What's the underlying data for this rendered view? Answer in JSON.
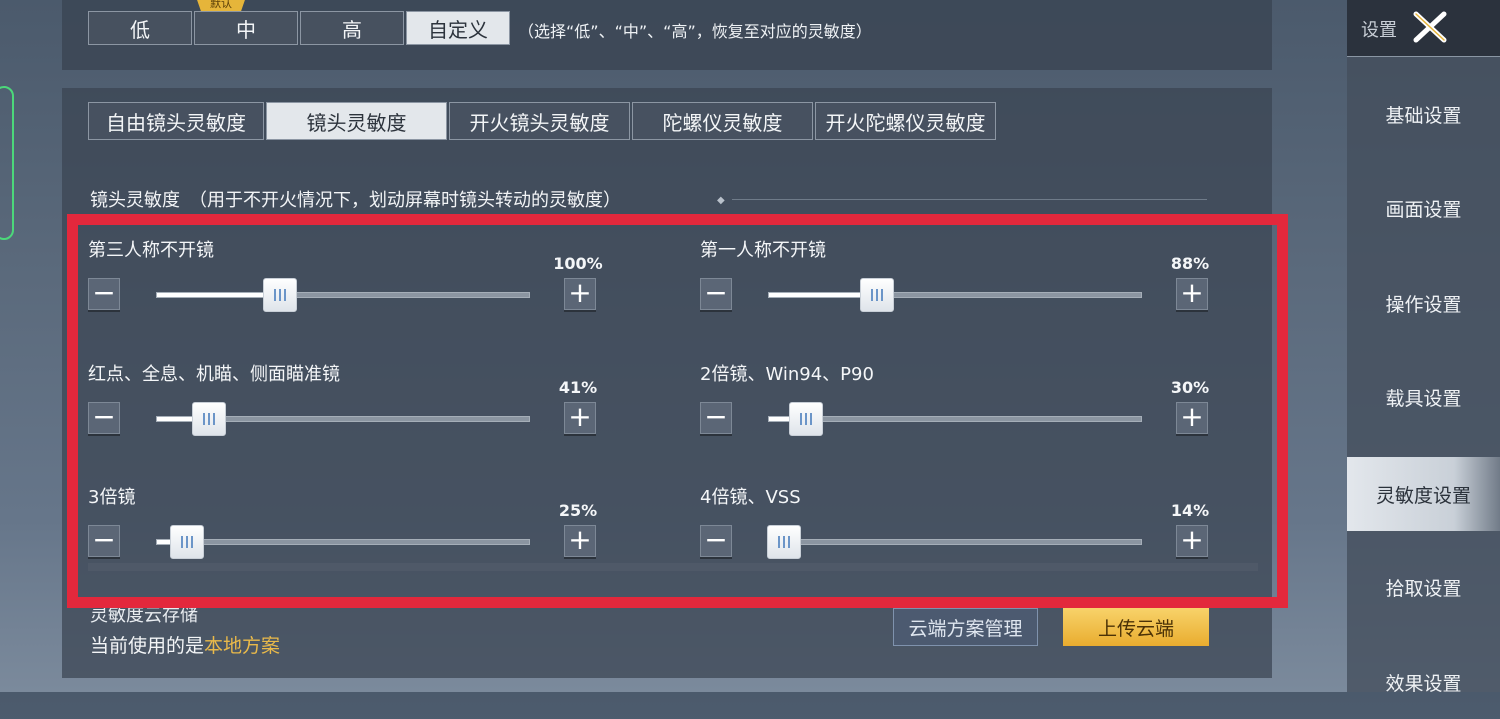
{
  "presets": {
    "options": [
      "低",
      "中",
      "高",
      "自定义"
    ],
    "active_index": 3,
    "default_badge": "默认",
    "hint": "（选择“低”、“中”、“高”，恢复至对应的灵敏度）"
  },
  "tabs": {
    "items": [
      "自由镜头灵敏度",
      "镜头灵敏度",
      "开火镜头灵敏度",
      "陀螺仪灵敏度",
      "开火陀螺仪灵敏度"
    ],
    "active_index": 1
  },
  "section": {
    "title": "镜头灵敏度　（用于不开火情况下，划动屏幕时镜头转动的灵敏度）"
  },
  "sliders": [
    {
      "label": "第三人称不开镜",
      "value_text": "100%",
      "fill": 0.33
    },
    {
      "label": "第一人称不开镜",
      "value_text": "88%",
      "fill": 0.29
    },
    {
      "label": "红点、全息、机瞄、侧面瞄准镜",
      "value_text": "41%",
      "fill": 0.14
    },
    {
      "label": "2倍镜、Win94、P90",
      "value_text": "30%",
      "fill": 0.1
    },
    {
      "label": "3倍镜",
      "value_text": "25%",
      "fill": 0.08
    },
    {
      "label": "4倍镜、VSS",
      "value_text": "14%",
      "fill": 0.04
    }
  ],
  "cloud": {
    "title": "灵敏度云存储",
    "status_prefix": "当前使用的是",
    "status_value": "本地方案",
    "manage_label": "云端方案管理",
    "upload_label": "上传云端"
  },
  "sidebar": {
    "title": "设置",
    "items": [
      "基础设置",
      "画面设置",
      "操作设置",
      "载具设置",
      "灵敏度设置",
      "拾取设置",
      "效果设置"
    ],
    "active_index": 4
  },
  "colors": {
    "highlight_frame": "#e3283c",
    "upload_button": "#f0bd45",
    "local_scheme_text": "#e9b94a"
  }
}
